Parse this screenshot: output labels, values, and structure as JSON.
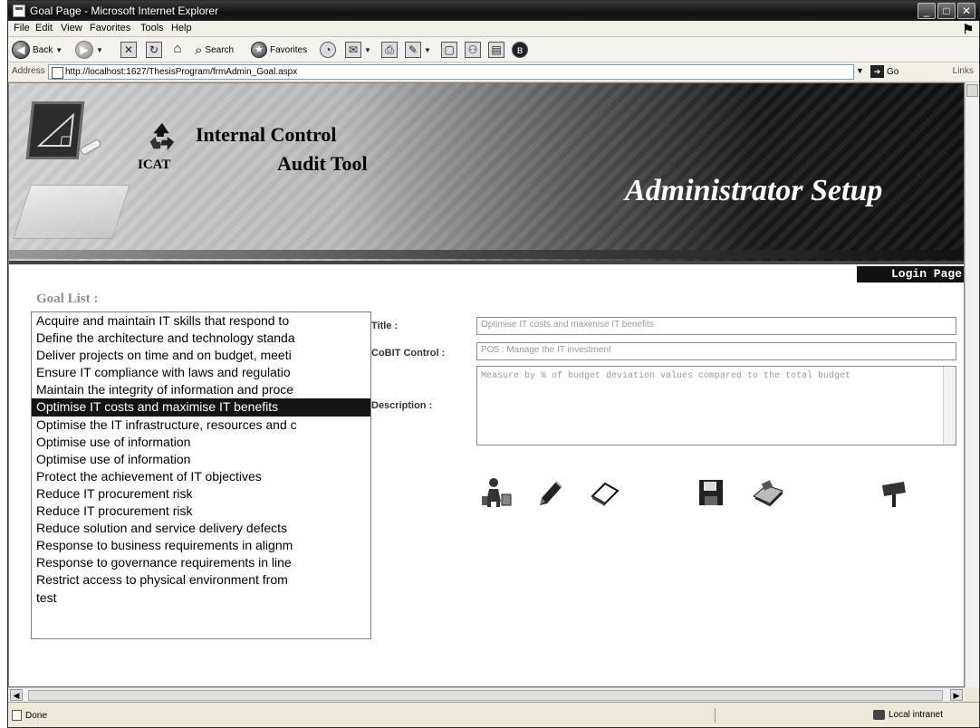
{
  "window": {
    "title": "Goal Page - Microsoft Internet Explorer"
  },
  "menu": [
    "File",
    "Edit",
    "View",
    "Favorites",
    "Tools",
    "Help"
  ],
  "toolbar": {
    "back_label": "Back",
    "search_label": "Search",
    "favorites_label": "Favorites"
  },
  "address": {
    "label": "Address",
    "url": "http://localhost:1627/ThesisProgram/frmAdmin_Goal.aspx",
    "go_label": "Go",
    "links_label": "Links"
  },
  "banner": {
    "title_line1": "Internal Control",
    "acronym": "ICAT",
    "title_line2": "Audit Tool",
    "section_title": "Administrator Setup"
  },
  "login_link": "Login Page",
  "goal_list": {
    "heading": "Goal List :",
    "selected_index": 5,
    "items": [
      "Acquire and maintain IT skills that respond to",
      "Define the architecture and technology standa",
      "Deliver projects on time and on budget, meeti",
      "Ensure IT compliance with laws and regulatio",
      "Maintain the integrity of information and proce",
      "Optimise IT costs and maximise IT benefits",
      "Optimise the IT infrastructure, resources and c",
      "Optimise use of information",
      "Optimise use of information",
      "Protect the achievement of IT objectives",
      "Reduce IT procurement risk",
      "Reduce IT procurement risk",
      "Reduce solution and service delivery defects",
      "Response to business requirements in alignm",
      "Response to governance requirements in line",
      "Restrict access to physical environment from",
      "test"
    ]
  },
  "form": {
    "title_label": "Title :",
    "title_value": "Optimise IT costs and maximise IT benefits",
    "cobit_label": "CoBIT Control :",
    "cobit_value": "PO5 : Manage the IT investment",
    "description_label": "Description :",
    "description_value": "Measure by % of budget deviation values compared to the total budget"
  },
  "status": {
    "left": "Done",
    "zone": "Local intranet"
  },
  "icons": [
    "add-user-icon",
    "edit-icon",
    "erase-icon",
    "save-icon",
    "cancel-icon",
    "exit-icon"
  ]
}
